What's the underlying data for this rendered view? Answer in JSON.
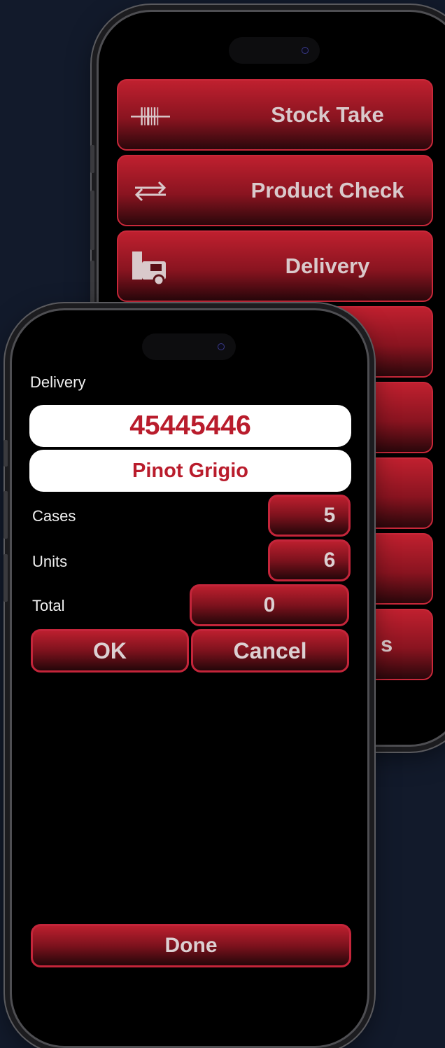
{
  "back_phone": {
    "menu_items": [
      {
        "label": "Stock Take",
        "icon": "barcode-icon"
      },
      {
        "label": "Product Check",
        "icon": "swap-arrows-icon"
      },
      {
        "label": "Delivery",
        "icon": "delivery-truck-icon"
      },
      {
        "label": "",
        "icon": ""
      },
      {
        "label": "",
        "icon": ""
      },
      {
        "label": "",
        "icon": ""
      },
      {
        "label": "",
        "icon": ""
      },
      {
        "label": "s",
        "icon": ""
      }
    ]
  },
  "front_phone": {
    "screen_title": "Delivery",
    "product_code": "45445446",
    "product_name": "Pinot Grigio",
    "cases_label": "Cases",
    "cases_value": "5",
    "units_label": "Units",
    "units_value": "6",
    "total_label": "Total",
    "total_value": "0",
    "ok_label": "OK",
    "cancel_label": "Cancel",
    "done_label": "Done"
  },
  "colors": {
    "background": "#121a2b",
    "button_red": "#c0202f",
    "button_border": "#c9283a",
    "value_text_red": "#b91c2c",
    "button_text": "#d9c9cb"
  }
}
